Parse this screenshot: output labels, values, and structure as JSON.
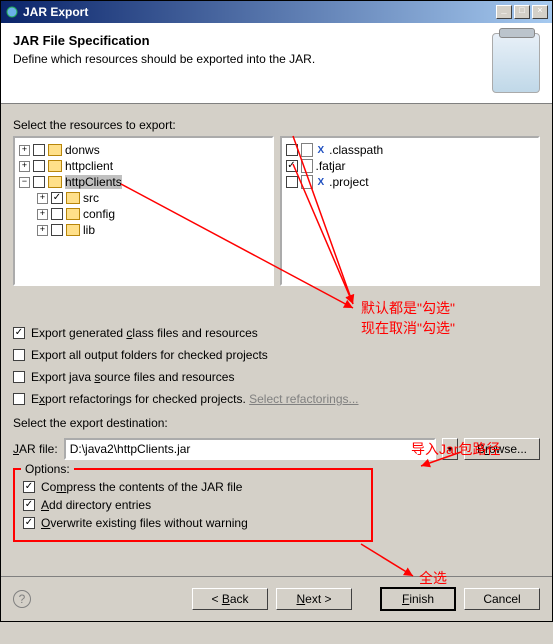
{
  "window": {
    "title": "JAR Export"
  },
  "header": {
    "title": "JAR File Specification",
    "subtitle": "Define which resources should be exported into the JAR."
  },
  "labels": {
    "select_resources": "Select the resources to export:",
    "select_destination": "Select the export destination:",
    "jar_file": "JAR file:",
    "options_group": "Options:"
  },
  "tree": {
    "items": [
      {
        "name": "donws",
        "expanded": false,
        "checked": false
      },
      {
        "name": "httpclient",
        "expanded": false,
        "checked": false
      },
      {
        "name": "httpClients",
        "expanded": true,
        "checked": false,
        "selected": true,
        "children": [
          {
            "name": "src",
            "checked": true
          },
          {
            "name": "config",
            "checked": false
          },
          {
            "name": "lib",
            "checked": false
          }
        ]
      }
    ]
  },
  "filelist": [
    {
      "name": ".classpath",
      "checked": false
    },
    {
      "name": ".fatjar",
      "checked": true
    },
    {
      "name": ".project",
      "checked": false
    }
  ],
  "export_options": [
    {
      "label": "Export generated class files and resources",
      "checked": true
    },
    {
      "label": "Export all output folders for checked projects",
      "checked": false
    },
    {
      "label": "Export java source files and resources",
      "checked": false
    },
    {
      "label_prefix": "Export refactorings for checked projects. ",
      "link": "Select refactorings...",
      "checked": false
    }
  ],
  "destination": {
    "value": "D:\\java2\\httpClients.jar",
    "browse": "Browse..."
  },
  "options": [
    {
      "label": "Compress the contents of the JAR file",
      "checked": true
    },
    {
      "label": "Add directory entries",
      "checked": true
    },
    {
      "label": "Overwrite existing files without warning",
      "checked": true
    }
  ],
  "buttons": {
    "back": "< Back",
    "next": "Next >",
    "finish": "Finish",
    "cancel": "Cancel"
  },
  "annotations": {
    "a1_line1": "默认都是\"勾选\"",
    "a1_line2": "现在取消\"勾选\"",
    "a2": "导入Jar包路径",
    "a3": "全选"
  }
}
